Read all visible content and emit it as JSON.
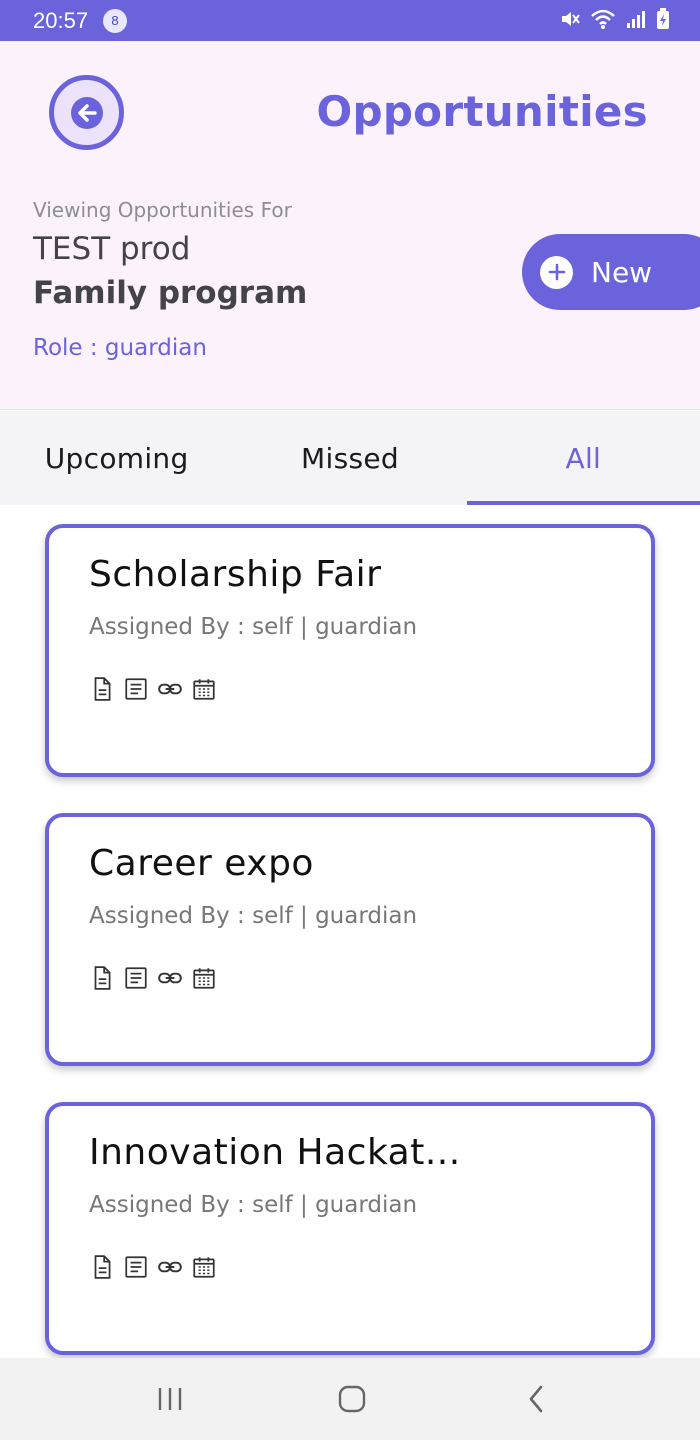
{
  "status_bar": {
    "time": "20:57",
    "notification_count": "8",
    "bg_color": "#6A63DC",
    "icons": [
      "mute-icon",
      "wifi-icon",
      "signal-icon",
      "battery-charging-icon"
    ]
  },
  "header": {
    "title": "Opportunities",
    "viewing_label": "Viewing Opportunities For",
    "org_name": "TEST prod",
    "program_name": "Family program",
    "role": "Role : guardian",
    "new_button_label": "New",
    "accent_color": "#6A63DC",
    "bg_color": "#FCF2FB"
  },
  "tabs": [
    {
      "label": "Upcoming",
      "active": false
    },
    {
      "label": "Missed",
      "active": false
    },
    {
      "label": "All",
      "active": true
    }
  ],
  "cards": [
    {
      "title": "Scholarship Fair",
      "assigned": "Assigned By : self | guardian",
      "icons": [
        "document-icon",
        "notes-icon",
        "link-icon",
        "calendar-icon"
      ]
    },
    {
      "title": "Career expo",
      "assigned": "Assigned By : self | guardian",
      "icons": [
        "document-icon",
        "notes-icon",
        "link-icon",
        "calendar-icon"
      ]
    },
    {
      "title": "Innovation Hackat...",
      "assigned": "Assigned By : self | guardian",
      "icons": [
        "document-icon",
        "notes-icon",
        "link-icon",
        "calendar-icon"
      ]
    }
  ],
  "nav_bar": {
    "buttons": [
      "recents-icon",
      "home-icon",
      "back-icon"
    ]
  }
}
